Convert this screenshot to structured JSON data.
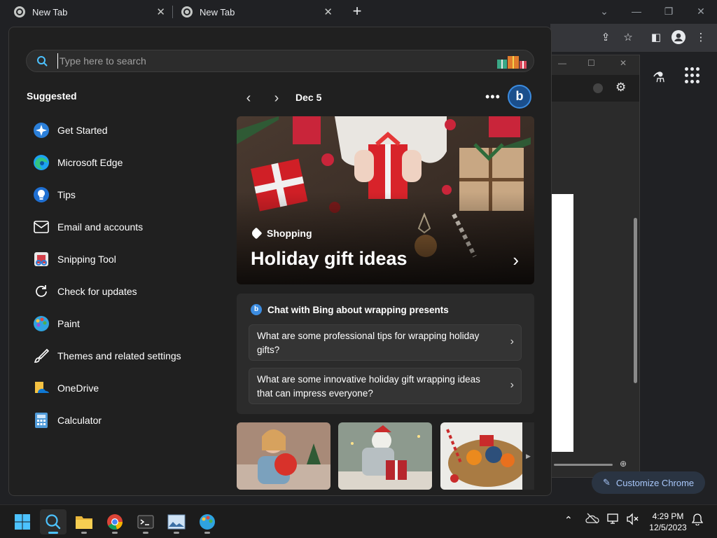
{
  "browser": {
    "tabs": [
      {
        "title": "New Tab"
      },
      {
        "title": "New Tab"
      }
    ]
  },
  "search": {
    "placeholder": "Type here to search"
  },
  "suggested": {
    "title": "Suggested",
    "apps": [
      {
        "label": "Get Started",
        "icon": "get-started-icon"
      },
      {
        "label": "Microsoft Edge",
        "icon": "edge-icon"
      },
      {
        "label": "Tips",
        "icon": "tips-icon"
      },
      {
        "label": "Email and accounts",
        "icon": "mail-icon"
      },
      {
        "label": "Snipping Tool",
        "icon": "snipping-tool-icon"
      },
      {
        "label": "Check for updates",
        "icon": "refresh-icon"
      },
      {
        "label": "Paint",
        "icon": "paint-icon"
      },
      {
        "label": "Themes and related settings",
        "icon": "brush-icon"
      },
      {
        "label": "OneDrive",
        "icon": "onedrive-icon"
      },
      {
        "label": "Calculator",
        "icon": "calculator-icon"
      }
    ]
  },
  "highlights": {
    "date": "Dec 5",
    "hero": {
      "tag": "Shopping",
      "title": "Holiday gift ideas"
    },
    "chat": {
      "title": "Chat with Bing about wrapping presents",
      "questions": [
        "What are some professional tips for wrapping holiday gifts?",
        "What are some innovative holiday gift wrapping ideas that can impress everyone?"
      ]
    }
  },
  "chrome": {
    "customize_label": "Customize Chrome"
  },
  "taskbar": {
    "time": "4:29 PM",
    "date": "12/5/2023"
  },
  "colors": {
    "panel_bg": "#202020",
    "taskbar_bg": "#1c1c1c",
    "accent": "#4cc2ff"
  }
}
